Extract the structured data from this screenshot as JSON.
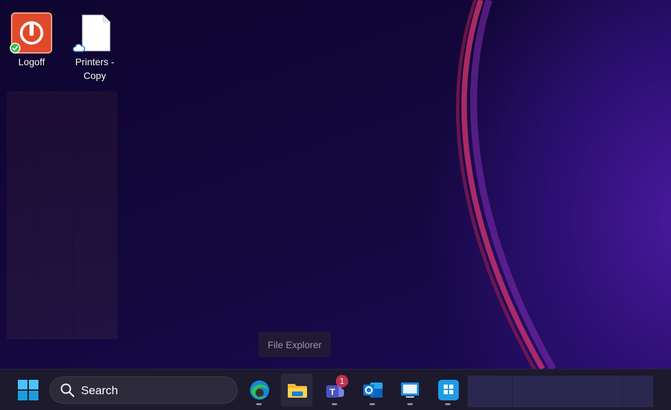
{
  "desktop": {
    "icons": [
      {
        "label": "Logoff"
      },
      {
        "label": "Printers -\nCopy"
      }
    ]
  },
  "tooltip": {
    "text": "File Explorer"
  },
  "taskbar": {
    "search_label": "Search",
    "teams_badge": "1",
    "apps": [
      {
        "name": "Microsoft Edge",
        "icon": "edge-icon"
      },
      {
        "name": "File Explorer",
        "icon": "folder-icon",
        "active": true
      },
      {
        "name": "Microsoft Teams",
        "icon": "teams-icon"
      },
      {
        "name": "Outlook",
        "icon": "outlook-icon"
      },
      {
        "name": "Remote Desktop",
        "icon": "remote-desktop-icon"
      },
      {
        "name": "Microsoft Store",
        "icon": "store-icon"
      }
    ]
  },
  "colors": {
    "accent": "#0078d4",
    "badge": "#c4314b",
    "logoff": "#e0492b"
  }
}
